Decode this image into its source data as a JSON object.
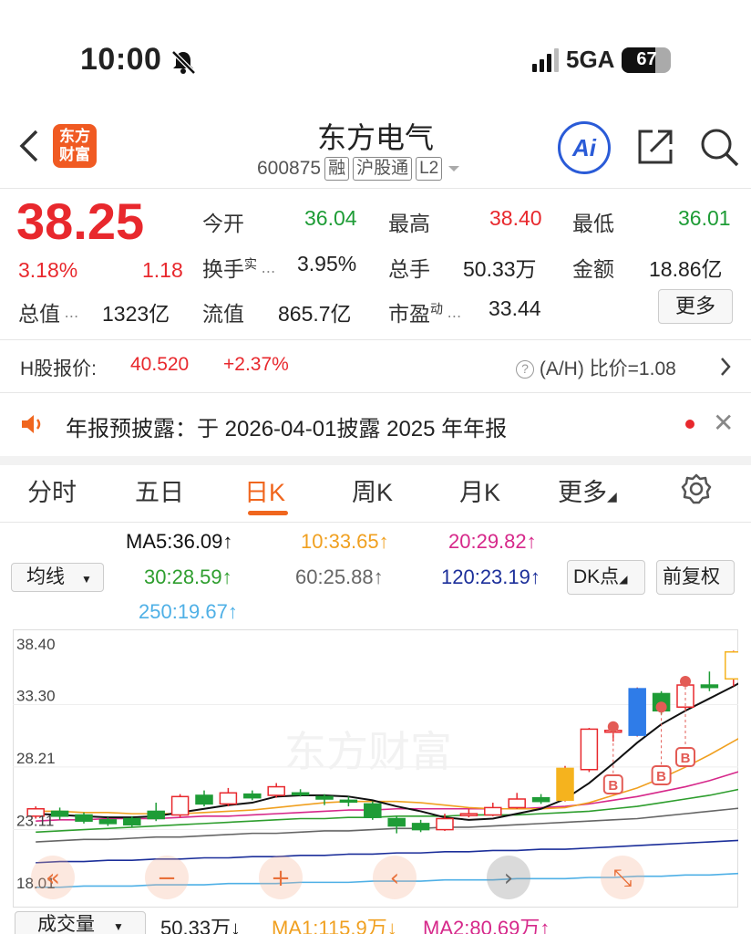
{
  "status": {
    "time": "10:00",
    "network": "5GA",
    "battery": "67"
  },
  "header": {
    "name": "东方电气",
    "code": "600875",
    "tags": [
      "融",
      "沪股通",
      "L2"
    ],
    "logo": "东方财富",
    "ai": "Ai"
  },
  "quote": {
    "price": "38.25",
    "pct": "3.18%",
    "change": "1.18",
    "open_label": "今开",
    "open": "36.04",
    "high_label": "最高",
    "high": "38.40",
    "low_label": "最低",
    "low": "36.01",
    "turnover_label": "换手",
    "turnover_sup": "实",
    "turnover": "3.95%",
    "volume_label": "总手",
    "volume": "50.33万",
    "amount_label": "金额",
    "amount": "18.86亿",
    "mktcap_label": "总值",
    "mktcap": "1323亿",
    "float_label": "流值",
    "float": "865.7亿",
    "pe_label": "市盈",
    "pe_sup": "动",
    "pe": "33.44",
    "more": "更多"
  },
  "hshare": {
    "label": "H股报价:",
    "price": "40.520",
    "pct": "+2.37%",
    "ah_label": "(A/H) 比价=1.08"
  },
  "notice": {
    "text": "年报预披露：于 2026-04-01披露 2025 年年报"
  },
  "tabs": [
    "分时",
    "五日",
    "日K",
    "周K",
    "月K",
    "更多"
  ],
  "indicators": {
    "selector": "均线",
    "ma5": "MA5:36.09↑",
    "ma10": "10:33.65↑",
    "ma20": "20:29.82↑",
    "ma30": "30:28.59↑",
    "ma60": "60:25.88↑",
    "ma120": "120:23.19↑",
    "ma250": "250:19.67↑",
    "dk": "DK点",
    "adjust": "前复权"
  },
  "colors": {
    "up": "#e8282d",
    "down": "#1e9c36",
    "ma5": "#111111",
    "ma10": "#f0a020",
    "ma20": "#d6288a",
    "ma30": "#2e9e2e",
    "ma60": "#666666",
    "ma120": "#1c2f9a",
    "ma250": "#4fb0e6"
  },
  "chart_data": {
    "type": "candlestick",
    "y_ticks": [
      "38.40",
      "33.30",
      "28.21",
      "23.11",
      "18.01"
    ],
    "ylim": [
      18.01,
      38.4
    ],
    "watermark": "东方财富",
    "candles": [
      {
        "o": 24.2,
        "c": 24.8,
        "h": 25.0,
        "l": 24.0
      },
      {
        "o": 24.6,
        "c": 24.2,
        "h": 24.9,
        "l": 23.9
      },
      {
        "o": 24.3,
        "c": 23.8,
        "h": 24.5,
        "l": 23.6
      },
      {
        "o": 23.9,
        "c": 23.6,
        "h": 24.1,
        "l": 23.4
      },
      {
        "o": 24.0,
        "c": 23.5,
        "h": 24.2,
        "l": 23.3
      },
      {
        "o": 24.6,
        "c": 24.0,
        "h": 25.3,
        "l": 23.8
      },
      {
        "o": 24.3,
        "c": 25.8,
        "h": 26.0,
        "l": 24.1
      },
      {
        "o": 25.9,
        "c": 25.2,
        "h": 26.3,
        "l": 25.0
      },
      {
        "o": 25.2,
        "c": 26.1,
        "h": 26.5,
        "l": 25.0
      },
      {
        "o": 26.0,
        "c": 25.7,
        "h": 26.3,
        "l": 25.5
      },
      {
        "o": 25.9,
        "c": 26.6,
        "h": 26.9,
        "l": 25.7
      },
      {
        "o": 26.1,
        "c": 26.0,
        "h": 26.4,
        "l": 25.8
      },
      {
        "o": 25.8,
        "c": 25.6,
        "h": 26.0,
        "l": 25.1
      },
      {
        "o": 25.5,
        "c": 25.4,
        "h": 25.8,
        "l": 25.0
      },
      {
        "o": 25.2,
        "c": 24.1,
        "h": 25.4,
        "l": 23.9
      },
      {
        "o": 24.0,
        "c": 23.4,
        "h": 24.2,
        "l": 22.8
      },
      {
        "o": 23.6,
        "c": 23.1,
        "h": 23.9,
        "l": 22.9
      },
      {
        "o": 23.1,
        "c": 24.0,
        "h": 24.4,
        "l": 23.0
      },
      {
        "o": 24.3,
        "c": 24.4,
        "h": 24.8,
        "l": 24.1
      },
      {
        "o": 24.3,
        "c": 24.9,
        "h": 25.3,
        "l": 24.2
      },
      {
        "o": 24.9,
        "c": 25.6,
        "h": 26.1,
        "l": 24.8
      },
      {
        "o": 25.7,
        "c": 25.4,
        "h": 26.0,
        "l": 25.2
      },
      {
        "o": 25.5,
        "c": 28.1,
        "h": 28.3,
        "l": 25.4
      },
      {
        "o": 28.0,
        "c": 31.3,
        "h": 31.4,
        "l": 27.8
      },
      {
        "o": 31.2,
        "c": 31.2,
        "h": 31.3,
        "l": 30.3
      },
      {
        "o": 30.8,
        "c": 34.6,
        "h": 34.7,
        "l": 30.7
      },
      {
        "o": 34.2,
        "c": 32.8,
        "h": 34.4,
        "l": 32.5
      },
      {
        "o": 33.1,
        "c": 34.9,
        "h": 35.5,
        "l": 32.9
      },
      {
        "o": 34.9,
        "c": 34.7,
        "h": 36.0,
        "l": 34.4
      },
      {
        "o": 35.4,
        "c": 37.6,
        "h": 37.7,
        "l": 34.8
      },
      {
        "o": 38.1,
        "c": 37.3,
        "h": 38.4,
        "l": 36.6
      },
      {
        "o": 36.04,
        "c": 38.25,
        "h": 38.4,
        "l": 36.01
      }
    ],
    "ma5": [
      24.4,
      24.3,
      24.2,
      24.1,
      24.1,
      24.2,
      24.5,
      24.8,
      25.1,
      25.3,
      25.8,
      25.9,
      25.9,
      25.8,
      25.5,
      25.0,
      24.6,
      24.1,
      23.9,
      24.0,
      24.4,
      24.8,
      25.6,
      26.9,
      28.5,
      30.2,
      31.7,
      32.8,
      33.8,
      34.8,
      35.9,
      36.9
    ],
    "ma10": [
      24.6,
      24.6,
      24.5,
      24.5,
      24.4,
      24.4,
      24.4,
      24.5,
      24.6,
      24.7,
      24.9,
      25.1,
      25.3,
      25.4,
      25.4,
      25.4,
      25.3,
      25.1,
      24.9,
      24.8,
      24.8,
      24.8,
      24.9,
      25.3,
      25.9,
      26.5,
      27.3,
      28.2,
      29.2,
      30.3,
      31.4,
      32.6
    ],
    "ma20": [
      23.8,
      23.9,
      23.9,
      24.0,
      24.0,
      24.0,
      24.1,
      24.2,
      24.2,
      24.3,
      24.4,
      24.5,
      24.6,
      24.7,
      24.7,
      24.8,
      24.8,
      24.8,
      24.8,
      24.8,
      24.8,
      24.9,
      25.0,
      25.2,
      25.5,
      25.8,
      26.2,
      26.6,
      27.1,
      27.7,
      28.3,
      28.9
    ],
    "ma30": [
      22.9,
      23.0,
      23.1,
      23.2,
      23.3,
      23.4,
      23.5,
      23.6,
      23.7,
      23.8,
      23.9,
      24.0,
      24.0,
      24.1,
      24.1,
      24.2,
      24.2,
      24.2,
      24.3,
      24.3,
      24.3,
      24.4,
      24.5,
      24.6,
      24.8,
      25.0,
      25.3,
      25.6,
      25.9,
      26.3,
      26.7,
      27.1
    ],
    "ma60": [
      22.1,
      22.2,
      22.3,
      22.3,
      22.4,
      22.5,
      22.5,
      22.6,
      22.7,
      22.8,
      22.8,
      22.9,
      23.0,
      23.0,
      23.1,
      23.2,
      23.2,
      23.3,
      23.3,
      23.4,
      23.5,
      23.6,
      23.7,
      23.8,
      23.9,
      24.0,
      24.2,
      24.4,
      24.6,
      24.8,
      25.0,
      25.3
    ],
    "ma120": [
      20.4,
      20.5,
      20.5,
      20.6,
      20.6,
      20.7,
      20.7,
      20.8,
      20.8,
      20.9,
      20.9,
      21.0,
      21.0,
      21.1,
      21.1,
      21.2,
      21.2,
      21.3,
      21.3,
      21.4,
      21.4,
      21.5,
      21.5,
      21.6,
      21.7,
      21.8,
      21.9,
      22.0,
      22.1,
      22.2,
      22.3,
      22.4
    ],
    "ma250": [
      18.4,
      18.4,
      18.5,
      18.5,
      18.5,
      18.6,
      18.6,
      18.6,
      18.7,
      18.7,
      18.7,
      18.8,
      18.8,
      18.8,
      18.9,
      18.9,
      18.9,
      19.0,
      19.0,
      19.0,
      19.1,
      19.1,
      19.1,
      19.2,
      19.2,
      19.3,
      19.3,
      19.4,
      19.4,
      19.5,
      19.6,
      19.7
    ],
    "b_markers": [
      {
        "i": 24,
        "label": "B"
      },
      {
        "i": 26,
        "label": "B"
      },
      {
        "i": 27,
        "label": "B"
      },
      {
        "i": 31,
        "label": "B"
      }
    ]
  },
  "nav_buttons": [
    "«",
    "−",
    "+",
    "‹",
    "›",
    "⤡"
  ],
  "volume": {
    "selector": "成交量",
    "value": "50.33万↓",
    "ma1": "MA1:115.9万↓",
    "ma2": "MA2:80.69万↑"
  }
}
